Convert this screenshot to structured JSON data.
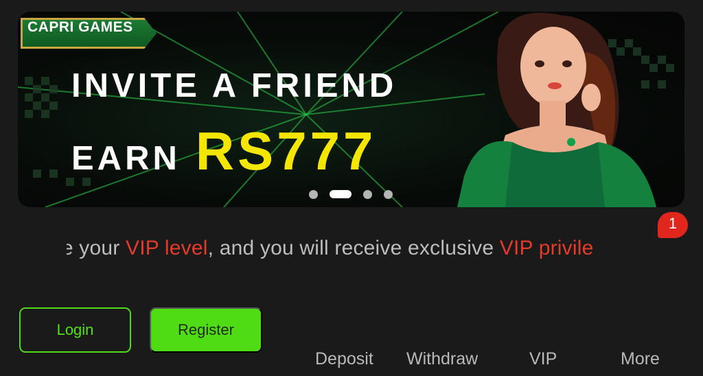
{
  "banner": {
    "brand": "CAPRI GAMES",
    "headline_line1": "INVITE A FRIEND",
    "headline_earn": "EARN",
    "headline_amount": "RS777",
    "carousel": {
      "total": 4,
      "active_index": 1
    }
  },
  "notification": {
    "count": "1"
  },
  "marquee": {
    "part1": "le your ",
    "highlight1": "VIP level",
    "part2": ", and you will receive exclusive ",
    "highlight2": "VIP privile"
  },
  "auth": {
    "login_label": "Login",
    "register_label": "Register"
  },
  "nav": {
    "items": [
      {
        "label": "Deposit"
      },
      {
        "label": "Withdraw"
      },
      {
        "label": "VIP"
      },
      {
        "label": "More"
      }
    ]
  },
  "colors": {
    "background": "#1a1a1a",
    "accent_green": "#4fdc14",
    "highlight_red": "#e63a2b",
    "amount_yellow": "#f5e600"
  }
}
